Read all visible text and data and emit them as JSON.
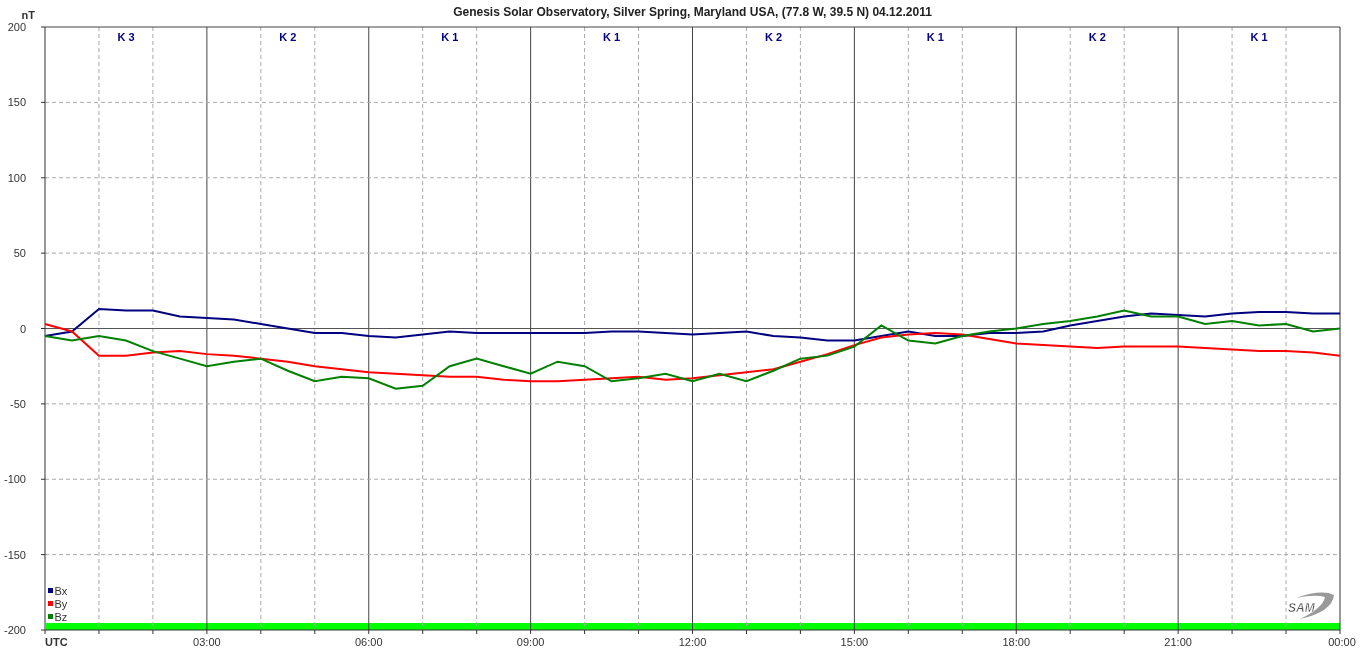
{
  "chart_data": {
    "type": "line",
    "title": "Genesis Solar Observatory, Silver Spring, Maryland USA, (77.8 W, 39.5 N)  04.12.2011",
    "xlabel": "UTC",
    "ylabel": "nT",
    "x": [
      0,
      0.5,
      1,
      1.5,
      2,
      2.5,
      3,
      3.5,
      4,
      4.5,
      5,
      5.5,
      6,
      6.5,
      7,
      7.5,
      8,
      8.5,
      9,
      9.5,
      10,
      10.5,
      11,
      11.5,
      12,
      12.5,
      13,
      13.5,
      14,
      14.5,
      15,
      15.5,
      16,
      16.5,
      17,
      17.5,
      18,
      18.5,
      19,
      19.5,
      20,
      20.5,
      21,
      21.5,
      22,
      22.5,
      23,
      23.5,
      24
    ],
    "series": [
      {
        "name": "Bx",
        "color": "#000080",
        "values": [
          -5,
          -2,
          13,
          12,
          12,
          8,
          7,
          6,
          3,
          0,
          -3,
          -3,
          -5,
          -6,
          -4,
          -2,
          -3,
          -3,
          -3,
          -3,
          -3,
          -2,
          -2,
          -3,
          -4,
          -3,
          -2,
          -5,
          -6,
          -8,
          -8,
          -5,
          -2,
          -5,
          -5,
          -3,
          -3,
          -2,
          2,
          5,
          8,
          10,
          9,
          8,
          10,
          11,
          11,
          10,
          10
        ]
      },
      {
        "name": "By",
        "color": "#ff0000",
        "values": [
          3,
          -2,
          -18,
          -18,
          -16,
          -15,
          -17,
          -18,
          -20,
          -22,
          -25,
          -27,
          -29,
          -30,
          -31,
          -32,
          -32,
          -34,
          -35,
          -35,
          -34,
          -33,
          -32,
          -34,
          -33,
          -31,
          -29,
          -27,
          -22,
          -17,
          -11,
          -6,
          -4,
          -3,
          -4,
          -7,
          -10,
          -11,
          -12,
          -13,
          -12,
          -12,
          -12,
          -13,
          -14,
          -15,
          -15,
          -16,
          -18
        ]
      },
      {
        "name": "Bz",
        "color": "#008000",
        "values": [
          -5,
          -8,
          -5,
          -8,
          -15,
          -20,
          -25,
          -22,
          -20,
          -28,
          -35,
          -32,
          -33,
          -40,
          -38,
          -25,
          -20,
          -25,
          -30,
          -22,
          -25,
          -35,
          -33,
          -30,
          -35,
          -30,
          -35,
          -28,
          -20,
          -18,
          -12,
          2,
          -8,
          -10,
          -5,
          -2,
          0,
          3,
          5,
          8,
          12,
          8,
          8,
          3,
          5,
          2,
          3,
          -2,
          0
        ]
      }
    ],
    "xlim": [
      0,
      24
    ],
    "ylim": [
      -200,
      200
    ],
    "grid": true,
    "xticks": [
      {
        "value": 3,
        "label": "03:00"
      },
      {
        "value": 6,
        "label": "06:00"
      },
      {
        "value": 9,
        "label": "09:00"
      },
      {
        "value": 12,
        "label": "12:00"
      },
      {
        "value": 15,
        "label": "15:00"
      },
      {
        "value": 18,
        "label": "18:00"
      },
      {
        "value": 21,
        "label": "21:00"
      },
      {
        "value": 24,
        "label": "00:00"
      }
    ],
    "yticks": [
      -200,
      -150,
      -100,
      -50,
      0,
      50,
      100,
      150,
      200
    ],
    "annotations": [
      "K 3",
      "K 2",
      "K 1",
      "K 1",
      "K 2",
      "K 1",
      "K 2",
      "K 1"
    ],
    "legend": true
  },
  "logo": {
    "text": "SAM"
  }
}
